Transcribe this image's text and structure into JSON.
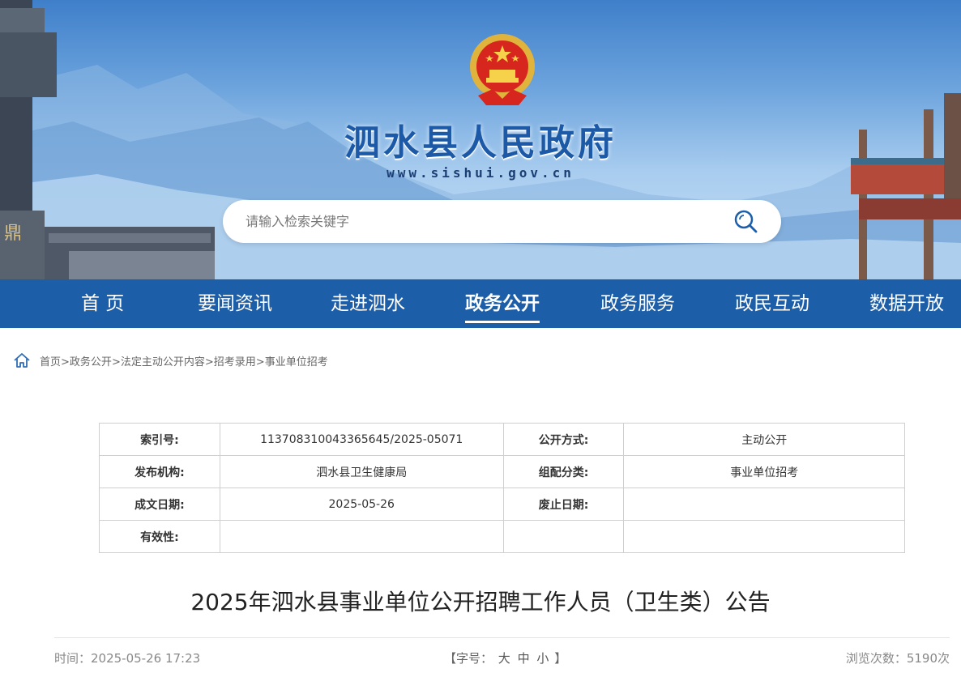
{
  "header": {
    "site_title": "泗水县人民政府",
    "site_url": "www.sishui.gov.cn",
    "emblem_icon": "national-emblem-icon",
    "search": {
      "placeholder": "请输入检索关键字",
      "icon": "search-icon"
    }
  },
  "nav": {
    "items": [
      {
        "label": "首 页"
      },
      {
        "label": "要闻资讯"
      },
      {
        "label": "走进泗水"
      },
      {
        "label": "政务公开",
        "active": true
      },
      {
        "label": "政务服务"
      },
      {
        "label": "政民互动"
      },
      {
        "label": "数据开放"
      }
    ]
  },
  "breadcrumb": {
    "icon": "home-icon",
    "items": [
      "首页",
      "政务公开",
      "法定主动公开内容",
      "招考录用",
      "事业单位招考"
    ],
    "separator": ">"
  },
  "info": {
    "rows": [
      {
        "label1": "索引号:",
        "value1": "113708310043365645/2025-05071",
        "label2": "公开方式:",
        "value2": "主动公开"
      },
      {
        "label1": "发布机构:",
        "value1": "泗水县卫生健康局",
        "label2": "组配分类:",
        "value2": "事业单位招考"
      },
      {
        "label1": "成文日期:",
        "value1": "2025-05-26",
        "label2": "废止日期:",
        "value2": ""
      },
      {
        "label1": "有效性:",
        "value1": "",
        "label2": "",
        "value2": ""
      }
    ]
  },
  "article": {
    "title": "2025年泗水县事业单位公开招聘工作人员（卫生类）公告",
    "time": "时间：2025-05-26 17:23",
    "font_size": {
      "prefix": "【字号：",
      "large": "大",
      "medium": "中",
      "small": "小",
      "suffix": "】"
    },
    "views": "浏览次数：5190次"
  },
  "colors": {
    "nav_bg": "#1d5ea9",
    "title_blue": "#1c5aa8"
  }
}
